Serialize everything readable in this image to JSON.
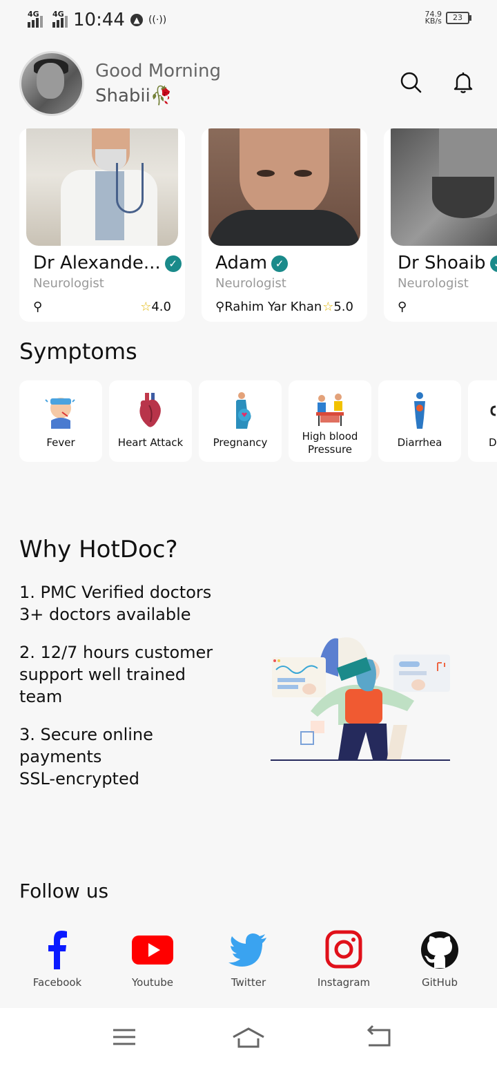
{
  "status_bar": {
    "network_1": "4G",
    "network_2": "4G",
    "time": "10:44",
    "speed_value": "74.9",
    "speed_unit": "KB/s",
    "battery": "23"
  },
  "header": {
    "greeting": "Good Morning",
    "user_name": "Shabii🥀"
  },
  "doctors": [
    {
      "name": "Dr Alexande...",
      "specialty": "Neurologist",
      "location": "",
      "rating": "4.0"
    },
    {
      "name": "Adam",
      "specialty": "Neurologist",
      "location": "Rahim Yar Khan",
      "rating": "5.0"
    },
    {
      "name": "Dr Shoaib",
      "specialty": "Neurologist",
      "location": "",
      "rating": ""
    }
  ],
  "symptoms": {
    "title": "Symptoms",
    "items": [
      {
        "label": "Fever",
        "icon": "fever-icon"
      },
      {
        "label": "Heart Attack",
        "icon": "heart-icon"
      },
      {
        "label": "Pregnancy",
        "icon": "pregnancy-icon"
      },
      {
        "label": "High blood Pressure",
        "icon": "blood-pressure-icon"
      },
      {
        "label": "Diarrhea",
        "icon": "diarrhea-icon"
      },
      {
        "label": "D",
        "icon": "symptom-icon"
      }
    ]
  },
  "why": {
    "title": "Why HotDoc?",
    "points": [
      [
        "1. PMC Verified doctors",
        "3+ doctors available"
      ],
      [
        "2. 12/7 hours customer",
        "support well trained",
        "team"
      ],
      [
        "3. Secure online",
        "payments",
        "SSL-encrypted"
      ]
    ]
  },
  "follow": {
    "title": "Follow us",
    "items": [
      {
        "label": "Facebook",
        "icon": "facebook-icon",
        "color": "#0a1aff"
      },
      {
        "label": "Youtube",
        "icon": "youtube-icon",
        "color": "#ff0000"
      },
      {
        "label": "Twitter",
        "icon": "twitter-icon",
        "color": "#3aa3f0"
      },
      {
        "label": "Instagram",
        "icon": "instagram-icon",
        "color": "#e0101a"
      },
      {
        "label": "GitHub",
        "icon": "github-icon",
        "color": "#111111"
      }
    ]
  },
  "colors": {
    "verified": "#1a8a8a",
    "star": "#e0b400",
    "background": "#f7f7f7"
  }
}
